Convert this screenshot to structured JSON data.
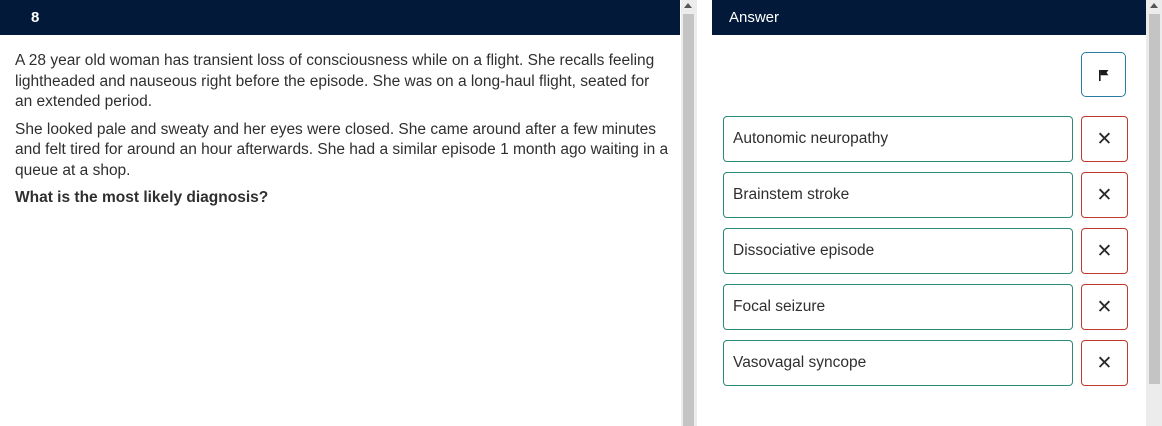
{
  "question": {
    "number": "8",
    "paragraphs": [
      "A 28 year old woman has transient loss of consciousness while on a flight. She recalls feeling lightheaded and nauseous right before the episode. She was on a long-haul flight, seated for an extended period.",
      "She looked pale and sweaty and her eyes were closed. She came around after a few minutes and felt tired for around an hour afterwards. She had a similar episode 1 month ago waiting in a queue at a shop."
    ],
    "prompt": "What is the most likely diagnosis?"
  },
  "answer_panel": {
    "title": "Answer",
    "flag_icon": "flag-icon",
    "strike_symbol": "✕",
    "options": [
      {
        "label": "Autonomic neuropathy"
      },
      {
        "label": "Brainstem stroke"
      },
      {
        "label": "Dissociative episode"
      },
      {
        "label": "Focal seizure"
      },
      {
        "label": "Vasovagal syncope"
      }
    ]
  },
  "colors": {
    "header_bg": "#02193a",
    "option_border": "#2b8a76",
    "strike_border": "#c0392b",
    "flag_border": "#2a7aa3"
  }
}
